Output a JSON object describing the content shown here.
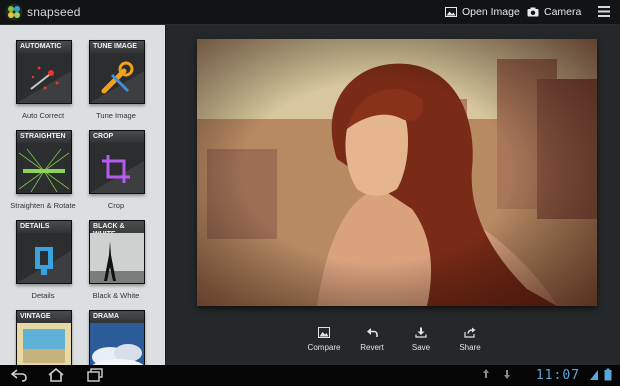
{
  "app": {
    "name": "snapseed"
  },
  "topbar": {
    "open_image": "Open Image",
    "camera": "Camera"
  },
  "tools": [
    {
      "tile_title": "AUTOMATIC",
      "label": "Auto Correct"
    },
    {
      "tile_title": "TUNE IMAGE",
      "label": "Tune Image"
    },
    {
      "tile_title": "STRAIGHTEN",
      "label": "Straighten & Rotate"
    },
    {
      "tile_title": "CROP",
      "label": "Crop"
    },
    {
      "tile_title": "DETAILS",
      "label": "Details"
    },
    {
      "tile_title": "BLACK & WHITE",
      "label": "Black & White"
    },
    {
      "tile_title": "VINTAGE",
      "label": ""
    },
    {
      "tile_title": "DRAMA",
      "label": ""
    }
  ],
  "actions": {
    "compare": "Compare",
    "revert": "Revert",
    "save": "Save",
    "share": "Share"
  },
  "status": {
    "time": "11:07"
  },
  "colors": {
    "accent_clock": "#5aa6d9",
    "sidebar_bg": "#dcdfe1",
    "main_bg": "#25282a"
  }
}
